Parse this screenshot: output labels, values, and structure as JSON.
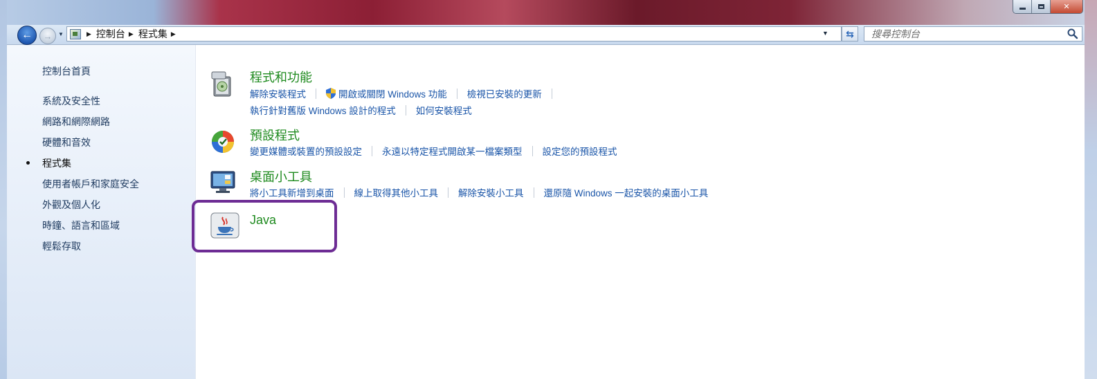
{
  "window": {
    "caption_buttons": [
      {
        "name": "minimize",
        "icon": "minimize-icon"
      },
      {
        "name": "maximize",
        "icon": "maximize-icon"
      },
      {
        "name": "close",
        "icon": "close-icon"
      }
    ]
  },
  "address_bar": {
    "breadcrumbs": [
      "控制台",
      "程式集"
    ],
    "icon": "control-panel-icon"
  },
  "search": {
    "placeholder": "搜尋控制台",
    "icon": "search-icon"
  },
  "nav_pane": {
    "home": "控制台首頁",
    "items": [
      {
        "label": "系統及安全性",
        "current": false
      },
      {
        "label": "網路和網際網路",
        "current": false
      },
      {
        "label": "硬體和音效",
        "current": false
      },
      {
        "label": "程式集",
        "current": true
      },
      {
        "label": "使用者帳戶和家庭安全",
        "current": false
      },
      {
        "label": "外觀及個人化",
        "current": false
      },
      {
        "label": "時鐘、語言和區域",
        "current": false
      },
      {
        "label": "輕鬆存取",
        "current": false
      }
    ]
  },
  "categories": [
    {
      "title": "程式和功能",
      "icon": "programs-features-icon",
      "links": [
        [
          "解除安裝程式",
          "開啟或關閉 Windows 功能",
          "檢視已安裝的更新"
        ],
        [
          "執行針對舊版 Windows 設計的程式",
          "如何安裝程式"
        ]
      ]
    },
    {
      "title": "預設程式",
      "icon": "default-programs-icon",
      "links": [
        [
          "變更媒體或裝置的預設設定",
          "永遠以特定程式開啟某一檔案類型",
          "設定您的預設程式"
        ]
      ]
    },
    {
      "title": "桌面小工具",
      "icon": "desktop-gadgets-icon",
      "links": [
        [
          "將小工具新增到桌面",
          "線上取得其他小工具",
          "解除安裝小工具",
          "還原隨 Windows 一起安裝的桌面小工具"
        ]
      ]
    },
    {
      "title": "Java",
      "icon": "java-icon",
      "links": []
    }
  ],
  "colors": {
    "category_title": "#1e8a1e",
    "link": "#1a55a8",
    "highlight": "#6d2c94"
  }
}
